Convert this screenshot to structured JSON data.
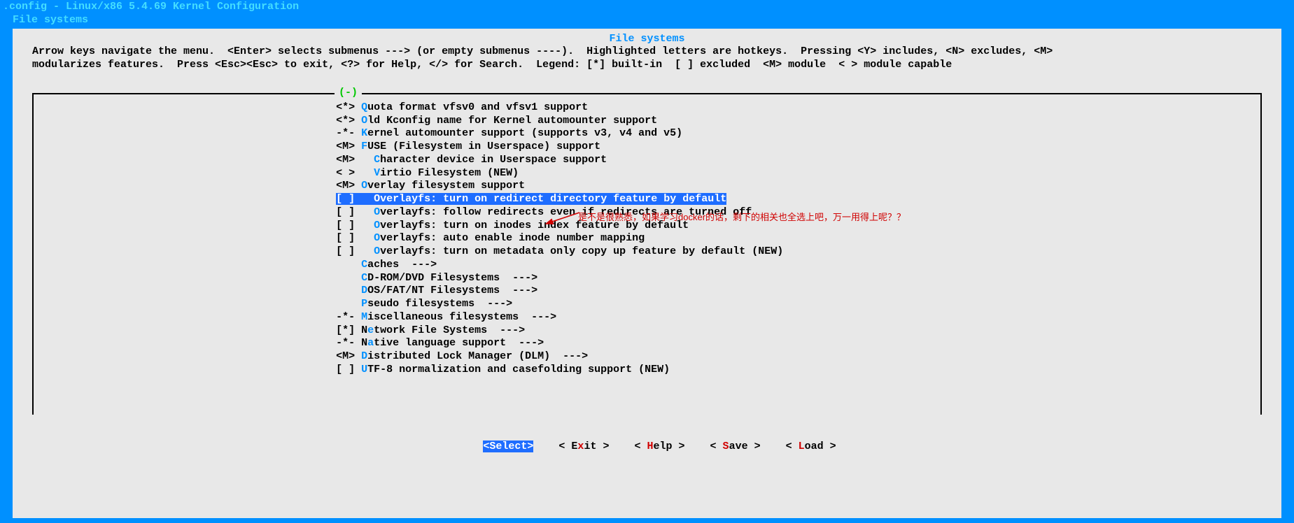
{
  "title": ".config - Linux/x86 5.4.69 Kernel Configuration",
  "breadcrumb": "File systems",
  "subtitle": "File systems",
  "help_line1": "Arrow keys navigate the menu.  <Enter> selects submenus ---> (or empty submenus ----).  Highlighted letters are hotkeys.  Pressing <Y> includes, <N> excludes, <M>",
  "help_line2": "modularizes features.  Press <Esc><Esc> to exit, <?> for Help, </> for Search.  Legend: [*] built-in  [ ] excluded  <M> module  < > module capable",
  "scroll_indicator": "(-)",
  "items": [
    {
      "prefix": "<*> ",
      "hk": "Q",
      "text": "uota format vfsv0 and vfsv1 support"
    },
    {
      "prefix": "<*> ",
      "hk": "O",
      "text": "ld Kconfig name for Kernel automounter support"
    },
    {
      "prefix": "-*- ",
      "hk": "K",
      "text": "ernel automounter support (supports v3, v4 and v5)"
    },
    {
      "prefix": "<M> ",
      "hk": "F",
      "text": "USE (Filesystem in Userspace) support"
    },
    {
      "prefix": "<M>   ",
      "hk": "C",
      "text": "haracter device in Userspace support"
    },
    {
      "prefix": "< >   ",
      "hk": "V",
      "text": "irtio Filesystem (NEW)"
    },
    {
      "prefix": "<M> ",
      "hk": "O",
      "text": "verlay filesystem support"
    },
    {
      "prefix": "[ ]   ",
      "hk": "O",
      "text": "verlayfs: turn on redirect directory feature by default",
      "selected": true,
      "selbox": "[ ]   "
    },
    {
      "prefix": "[ ]   ",
      "hk": "O",
      "text": "verlayfs: follow redirects even if redirects are turned off"
    },
    {
      "prefix": "[ ]   ",
      "hk": "O",
      "text": "verlayfs: turn on inodes index feature by default"
    },
    {
      "prefix": "[ ]   ",
      "hk": "O",
      "text": "verlayfs: auto enable inode number mapping"
    },
    {
      "prefix": "[ ]   ",
      "hk": "O",
      "text": "verlayfs: turn on metadata only copy up feature by default (NEW)"
    },
    {
      "prefix": "    ",
      "hk": "C",
      "text": "aches  --->"
    },
    {
      "prefix": "    ",
      "hk": "C",
      "text": "D-ROM/DVD Filesystems  --->"
    },
    {
      "prefix": "    ",
      "hk": "D",
      "text": "OS/FAT/NT Filesystems  --->"
    },
    {
      "prefix": "    ",
      "hk": "P",
      "text": "seudo filesystems  --->"
    },
    {
      "prefix": "-*- ",
      "hk": "M",
      "text": "iscellaneous filesystems  --->"
    },
    {
      "prefix": "[*] ",
      "hk_pre": "N",
      "hk": "e",
      "text": "twork File Systems  --->"
    },
    {
      "prefix": "-*- ",
      "hk_pre": "N",
      "hk": "a",
      "text": "tive language support  --->"
    },
    {
      "prefix": "<M> ",
      "hk": "D",
      "text": "istributed Lock Manager (DLM)  --->"
    },
    {
      "prefix": "[ ] ",
      "hk": "U",
      "text": "TF-8 normalization and casefolding support (NEW)"
    }
  ],
  "buttons": {
    "select": "<Select>",
    "exit_pre": "< E",
    "exit_hk": "x",
    "exit_post": "it >",
    "help_pre": "< ",
    "help_hk": "H",
    "help_post": "elp >",
    "save_pre": "< ",
    "save_hk": "S",
    "save_post": "ave >",
    "load_pre": "< ",
    "load_hk": "L",
    "load_post": "oad >"
  },
  "annotation": "是不是很熟悉，如果学习docker的话，剩下的相关也全选上吧，万一用得上呢？？",
  "indent": "                                                "
}
